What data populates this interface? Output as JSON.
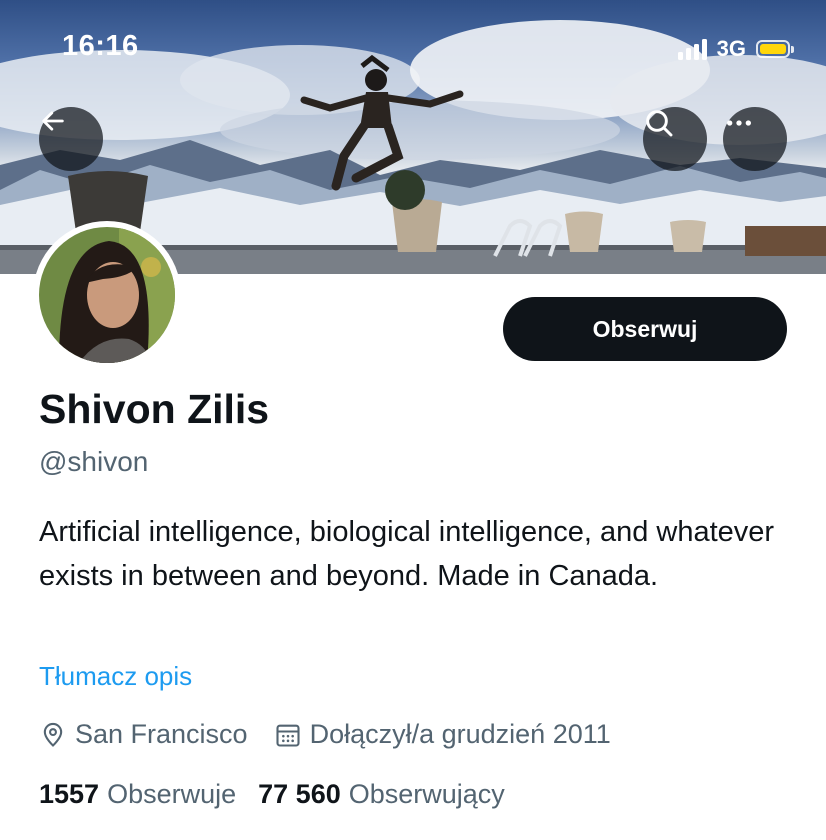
{
  "status_bar": {
    "time": "16:16",
    "network": "3G"
  },
  "header_actions": {
    "back_icon": "arrow-left-icon",
    "search_icon": "search-icon",
    "more_icon": "more-horizontal-icon"
  },
  "profile": {
    "name": "Shivon Zilis",
    "handle": "@shivon",
    "bio": "Artificial intelligence, biological intelligence, and whatever exists in between and beyond. Made in Canada.",
    "translate_label": "Tłumacz opis",
    "follow_label": "Obserwuj",
    "location": "San Francisco",
    "joined": "Dołączył/a grudzień 2011",
    "following_count": "1557",
    "following_label": "Obserwuje",
    "followers_count": "77 560",
    "followers_label": "Obserwujący"
  },
  "colors": {
    "accent_link": "#1d9bf0",
    "text_primary": "#0f1419",
    "text_secondary": "#536471",
    "battery": "#ffd60a"
  }
}
